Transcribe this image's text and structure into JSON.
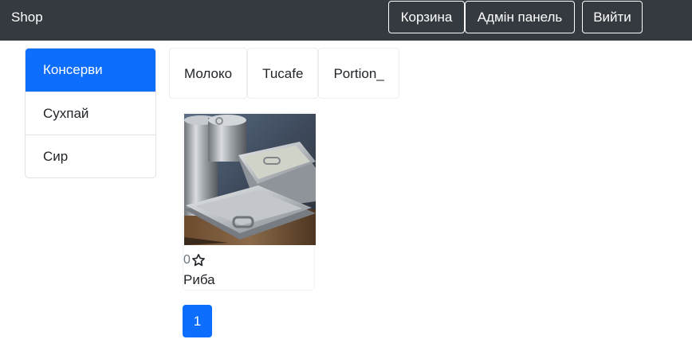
{
  "navbar": {
    "brand": "Shop",
    "cart_label": "Корзина",
    "admin_label": "Адмін панель",
    "logout_label": "Вийти"
  },
  "types": {
    "items": [
      {
        "label": "Консерви",
        "active": true
      },
      {
        "label": "Сухпай",
        "active": false
      },
      {
        "label": "Сир",
        "active": false
      }
    ]
  },
  "brands": {
    "items": [
      {
        "label": "Молоко"
      },
      {
        "label": "Tucafe"
      },
      {
        "label": "Portion_"
      }
    ]
  },
  "products": [
    {
      "rating": "0",
      "name": "Риба",
      "image": "canned-food-photo"
    }
  ],
  "pagination": {
    "pages": [
      "1"
    ],
    "active": "1"
  },
  "colors": {
    "navbar_bg": "#343a40",
    "accent": "#0d6efd"
  }
}
